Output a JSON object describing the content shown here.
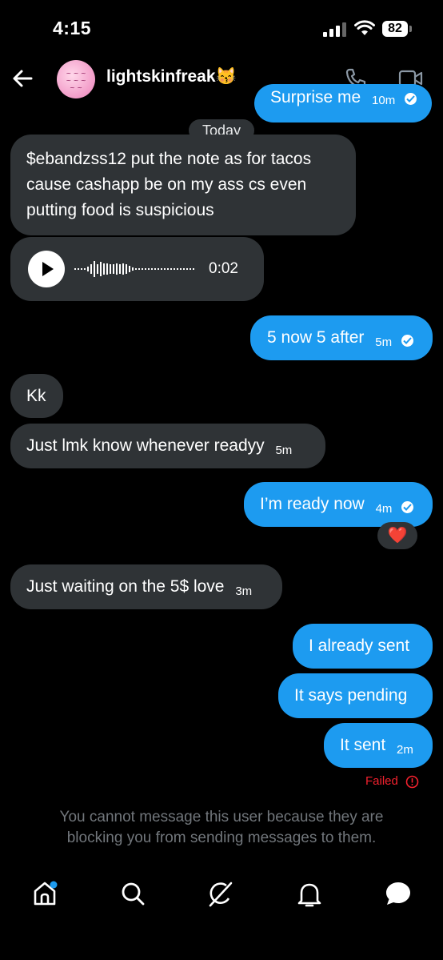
{
  "status_bar": {
    "time": "4:15",
    "battery": "82"
  },
  "header": {
    "username": "lightskinfreak😽"
  },
  "top_partial_message": {
    "text": "Surprise me",
    "time": "10m"
  },
  "date_divider": "Today",
  "messages": [
    {
      "side": "in",
      "text": "$ebandzss12 put the note as for tacos cause cashapp be on my ass cs even putting food is suspicious"
    },
    {
      "side": "in",
      "type": "voice",
      "duration": "0:02"
    },
    {
      "side": "out",
      "text": "5 now 5 after",
      "time": "5m",
      "read": true
    },
    {
      "side": "in",
      "text": "Kk"
    },
    {
      "side": "in",
      "text": "Just lmk know whenever readyy",
      "time": "5m"
    },
    {
      "side": "out",
      "text": "I’m ready now",
      "time": "4m",
      "read": true,
      "reaction": "❤️"
    },
    {
      "side": "in",
      "text": "Just waiting on the 5$ love",
      "time": "3m"
    },
    {
      "side": "out",
      "text": "I already sent"
    },
    {
      "side": "out",
      "text": "It says pending"
    },
    {
      "side": "out",
      "text": "It sent",
      "time": "2m"
    }
  ],
  "failed_label": "Failed",
  "blocked_notice": "You cannot message this user because they are blocking you from sending messages to them.",
  "bottom_nav": [
    "home-icon",
    "search-icon",
    "grok-icon",
    "notifications-icon",
    "messages-icon"
  ],
  "colors": {
    "accent": "#1d9bf0",
    "incoming": "#2f3336",
    "error": "#f4212e",
    "muted": "#71767b"
  }
}
